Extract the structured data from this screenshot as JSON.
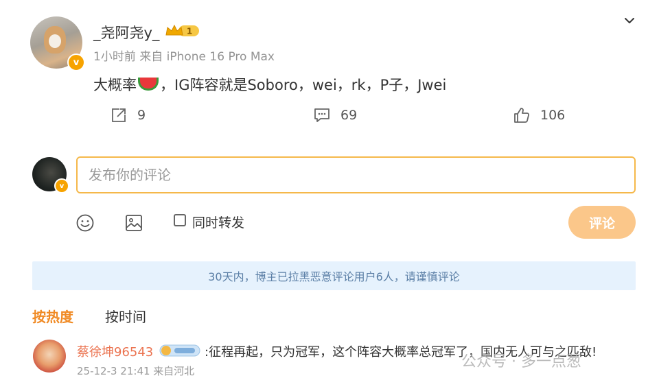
{
  "post": {
    "username": "_尧阿尧y_",
    "vip_level": "1",
    "meta": "1小时前 来自 iPhone 16 Pro Max",
    "text_before": "大概率",
    "text_after": "，IG阵容就是Soboro，wei，rk，P子，Jwei",
    "repost_count": "9",
    "comment_count": "69",
    "like_count": "106",
    "verified_mark": "v"
  },
  "composer": {
    "placeholder": "发布你的评论",
    "repost_label": "同时转发",
    "submit_label": "评论",
    "verified_mark": "v"
  },
  "notice": "30天内，博主已拉黑恶意评论用户6人，请谨慎评论",
  "sort": {
    "hot_label": "按热度",
    "time_label": "按时间"
  },
  "comment": {
    "name": "蔡徐坤96543",
    "text": ":征程再起，只为冠军，这个阵容大概率总冠军了，国内无人可与之匹敌!",
    "meta": "25-12-3 21:41 来自河北"
  },
  "watermark": "公众号 · 多一点葱",
  "colors": {
    "accent_orange": "#f08a24",
    "submit_button": "#fbc78a",
    "input_border": "#f5b84a",
    "notice_bg": "#e6f2fd",
    "notice_text": "#5b7fa6",
    "commenter_name": "#eb7350"
  },
  "icons": [
    "chevron-down-icon",
    "repost-icon",
    "comment-icon",
    "like-icon",
    "emoji-icon",
    "image-icon",
    "vip-crown-icon",
    "verified-badge-icon",
    "watermelon-emoji-icon"
  ]
}
